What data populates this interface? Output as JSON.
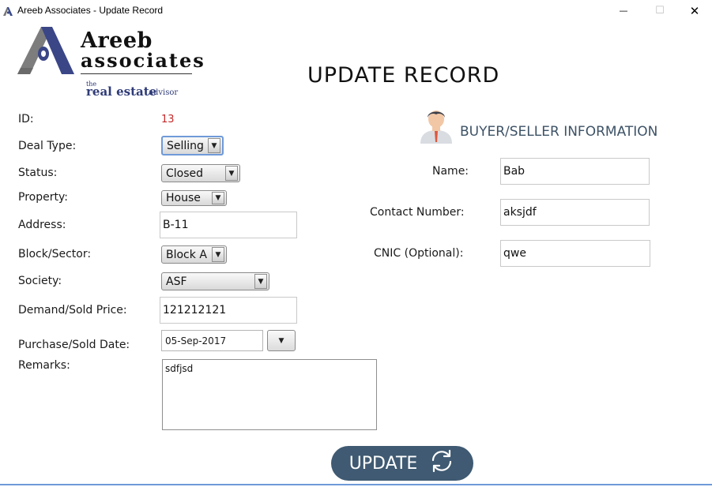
{
  "window": {
    "title": "Areeb Associates - Update Record",
    "min_glyph": "—",
    "max_glyph": "☐",
    "close_glyph": "✕"
  },
  "logo": {
    "brand_line1": "Areeb",
    "brand_line2": "associates",
    "tagline_the": "the",
    "tagline_main": "real estate",
    "tagline_advisor": "advisor"
  },
  "page_title": "UPDATE RECORD",
  "form": {
    "id_label": "ID:",
    "id_value": "13",
    "deal_type_label": "Deal Type:",
    "deal_type_value": "Selling",
    "status_label": "Status:",
    "status_value": "Closed",
    "property_label": "Property:",
    "property_value": "House",
    "address_label": "Address:",
    "address_value": "B-11",
    "block_label": "Block/Sector:",
    "block_value": "Block A",
    "society_label": "Society:",
    "society_value": "ASF",
    "price_label": "Demand/Sold Price:",
    "price_value": "121212121",
    "date_label": "Purchase/Sold Date:",
    "date_value": "05-Sep-2017",
    "remarks_label": "Remarks:",
    "remarks_value": "sdfjsd",
    "dropdown_glyph": "▼"
  },
  "buyer": {
    "section_title": "BUYER/SELLER INFORMATION",
    "name_label": "Name:",
    "name_value": "Bab",
    "contact_label": "Contact Number:",
    "contact_value": "aksjdf",
    "cnic_label": "CNIC (Optional):",
    "cnic_value": "qwe"
  },
  "update_button": {
    "label": "UPDATE",
    "icon": "refresh-icon"
  },
  "colors": {
    "accent_button": "#3f5a72",
    "id_value": "#c62828",
    "section_title": "#3d5266",
    "focus_border": "#6f9ad8"
  }
}
